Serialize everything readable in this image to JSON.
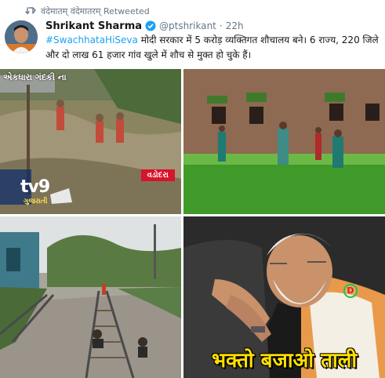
{
  "retweet": {
    "icon": "retweet-icon",
    "label": "वंदेमातम् वंदेमातरम् Retweeted"
  },
  "author": {
    "name": "Shrikant Sharma",
    "verified_icon": "verified-badge-icon",
    "handle": "@ptshrikant",
    "separator": "·",
    "time": "22h",
    "avatar_color": "#c96a2a"
  },
  "tweet": {
    "hashtag": "#SwachhataHiSeva",
    "text": " मोदी सरकार में 5 करोड़ व्यक्तिगत शौचालय बने। 6 राज्य, 220 जिले और दो लाख 61 हजार गांव खुले में शौच से मुक्त हो चुके हैं।",
    "hashtag_color": "#1da1f2"
  },
  "media": {
    "photo1": {
      "overlay_gujarati": "એકધારા ગંદકી ના",
      "channel": "tv9",
      "channel_sub": "ગુજરાતી",
      "location": "વડોદરા"
    },
    "photo4": {
      "caption": "भक्तो बजाओ ताली",
      "badge": "D"
    }
  }
}
